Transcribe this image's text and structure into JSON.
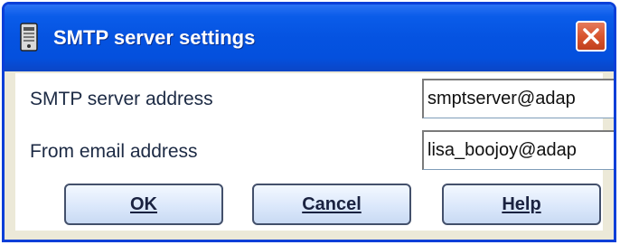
{
  "window": {
    "title": "SMTP server settings",
    "icon": "server-settings-icon",
    "close_icon": "close-icon",
    "accent_color": "#0553e1",
    "close_color": "#d8552f"
  },
  "form": {
    "smtp_label": "SMTP server address",
    "smtp_value": "smptserver@adap",
    "from_label": "From email address",
    "from_value": "lisa_boojoy@adap"
  },
  "buttons": {
    "ok": "OK",
    "cancel": "Cancel",
    "help": "Help"
  }
}
